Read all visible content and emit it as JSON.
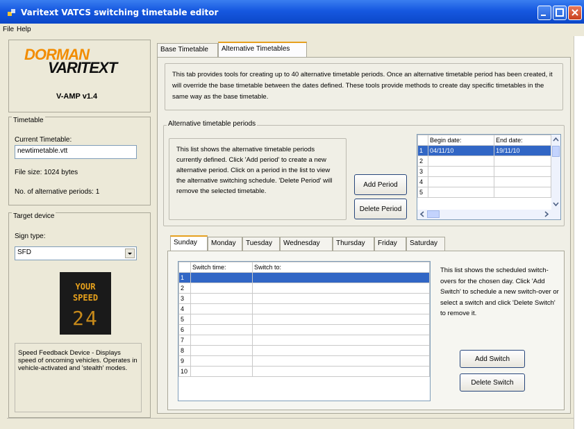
{
  "window": {
    "title": "Varitext VATCS switching timetable editor"
  },
  "menu": {
    "items": [
      "File",
      "Help"
    ]
  },
  "logo": {
    "brand_top": "DORMAN",
    "brand_bottom": "VARITEXT",
    "version": "V-AMP v1.4"
  },
  "timetable": {
    "legend": "Timetable",
    "current_label": "Current Timetable:",
    "current_value": "newtimetable.vtt",
    "file_size": "File size:  1024 bytes",
    "alt_periods": "No. of alternative periods:  1"
  },
  "target": {
    "legend": "Target device",
    "sign_type_label": "Sign type:",
    "sign_type_value": "SFD",
    "sign_line1": "YOUR",
    "sign_line2": "SPEED",
    "sign_number": "24",
    "description": "Speed Feedback Device - Displays speed of oncoming vehicles. Operates in vehicle-activated and 'stealth' modes."
  },
  "tabs": [
    "Base Timetable",
    "Alternative Timetables"
  ],
  "intro": "This tab provides tools for creating up to 40 alternative timetable periods. Once an alternative timetable period has been created, it will override the base timetable between the dates defined. These tools provide methods to create day specific timetables in the same way as the base timetable.",
  "periods": {
    "legend": "Alternative timetable periods",
    "description": "This list shows the alternative timetable periods currently defined. Click 'Add period' to create a new alternative period. Click on a period in the list to view the alternative switching schedule. 'Delete Period' will remove the selected timetable.",
    "add_button": "Add Period",
    "delete_button": "Delete Period",
    "columns": [
      "",
      "Begin date:",
      "End date:"
    ],
    "rows": [
      [
        "1",
        "04/11/10",
        "19/11/10"
      ],
      [
        "2",
        "",
        ""
      ],
      [
        "3",
        "",
        ""
      ],
      [
        "4",
        "",
        ""
      ],
      [
        "5",
        "",
        ""
      ]
    ]
  },
  "days": {
    "tabs": [
      "Sunday",
      "Monday",
      "Tuesday",
      "Wednesday",
      "Thursday",
      "Friday",
      "Saturday"
    ],
    "columns": [
      "",
      "Switch time:",
      "Switch to:"
    ],
    "rows": [
      "1",
      "2",
      "3",
      "4",
      "5",
      "6",
      "7",
      "8",
      "9",
      "10"
    ],
    "description": "This list shows the scheduled switch-overs for the chosen day. Click 'Add Switch' to schedule a new switch-over or select a switch and click 'Delete Switch' to remove it.",
    "add_button": "Add Switch",
    "delete_button": "Delete Switch"
  },
  "colors": {
    "title_bar": "#0b47c8",
    "selection": "#3166c5",
    "tab_highlight": "#e6a01e",
    "sign_led": "#e8a21c"
  }
}
